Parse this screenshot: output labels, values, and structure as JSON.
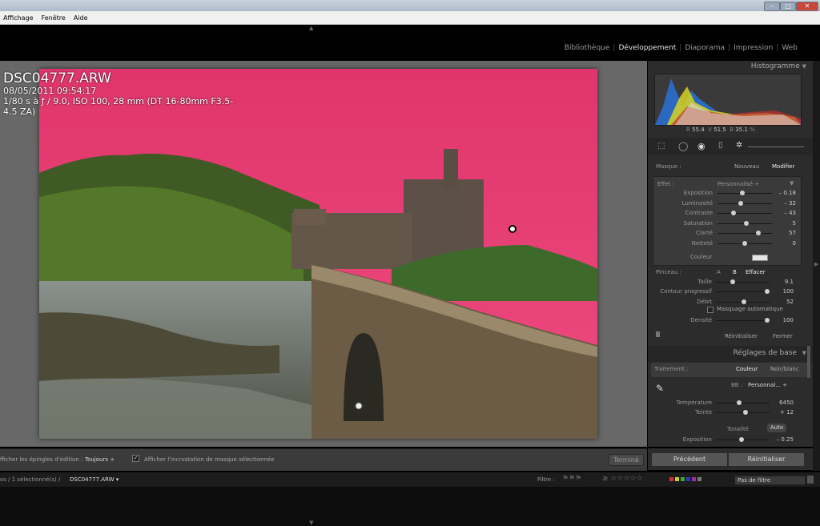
{
  "menu": {
    "items": [
      "Affichage",
      "Fenêtre",
      "Aide"
    ]
  },
  "window_controls": {
    "minimize": "–",
    "maximize": "□",
    "close": "✕"
  },
  "modules": {
    "items": [
      "Bibliothèque",
      "Développement",
      "Diaporama",
      "Impression",
      "Web"
    ],
    "active": "Développement"
  },
  "photo_info": {
    "filename": "DSC04777.ARW",
    "datetime": "08/05/2011 09:54:17",
    "exposure_line1": "1/80 s à ƒ / 9.0, ISO 100, 28 mm (DT 16-80mm F3.5-",
    "exposure_line2": "4.5 ZA)"
  },
  "histogram": {
    "title": "Histogramme",
    "r_label": "R",
    "r_value": "55.4",
    "g_label": "V",
    "g_value": "51.5",
    "b_label": "B",
    "b_value": "35.1",
    "unit": "%"
  },
  "mask": {
    "label": "Masque :",
    "new_btn": "Nouveau",
    "edit_btn": "Modifier"
  },
  "effect": {
    "label": "Effet :",
    "preset": "Personnalisé ÷",
    "sliders": [
      {
        "name": "Exposition",
        "value": "– 0.18",
        "pos": 0.45
      },
      {
        "name": "Luminosité",
        "value": "– 32",
        "pos": 0.42
      },
      {
        "name": "Contraste",
        "value": "– 43",
        "pos": 0.3
      },
      {
        "name": "Saturation",
        "value": "5",
        "pos": 0.53
      },
      {
        "name": "Clarté",
        "value": "57",
        "pos": 0.75
      },
      {
        "name": "Netteté",
        "value": "0",
        "pos": 0.5
      }
    ],
    "color_label": "Couleur"
  },
  "brush": {
    "label": "Pinceau :",
    "a_btn": "A",
    "b_btn": "B",
    "erase_btn": "Effacer",
    "size_label": "Taille",
    "size_value": "9.1",
    "size_pos": 0.3,
    "feather_label": "Contour progressif",
    "feather_value": "100",
    "feather_pos": 0.95,
    "flow_label": "Débit",
    "flow_value": "52",
    "flow_pos": 0.52,
    "automask_label": "Masquage automatique",
    "density_label": "Densité",
    "density_value": "100",
    "density_pos": 0.95,
    "reset_btn": "Réinitialiser",
    "close_btn": "Fermer"
  },
  "basic": {
    "title": "Réglages de base",
    "treatment_label": "Traitement :",
    "color_btn": "Couleur",
    "bw_btn": "Noir/blanc",
    "wb_label": "BB :",
    "wb_value": "Personnal... ÷",
    "temp_label": "Température",
    "temp_value": "6450",
    "temp_pos": 0.42,
    "tint_label": "Teinte",
    "tint_value": "+ 12",
    "tint_pos": 0.55,
    "tone_label": "Tonalité",
    "auto_btn": "Auto",
    "exposure_label": "Exposition",
    "exposure_value": "– 0.25",
    "exposure_pos": 0.47
  },
  "toolbar": {
    "pins_label": "fficher les épingles d'édition :",
    "pins_value": "Toujours ÷",
    "overlay_label": "Afficher l'incrustation de masque sélectionnée",
    "done_btn": "Terminé"
  },
  "nav_buttons": {
    "previous": "Précédent",
    "reset": "Réinitialiser"
  },
  "filmstrip": {
    "path_prefix": "os / 1 sélectionné(s) /",
    "path_file": "DSC04777.ARW ▾",
    "filter_label": "Filtre :",
    "filter_value": "Pas de filtre"
  },
  "colors": {
    "mask_overlay": "#e8346a",
    "panel_bg": "#2c2c2c",
    "viewer_bg": "#686868"
  }
}
